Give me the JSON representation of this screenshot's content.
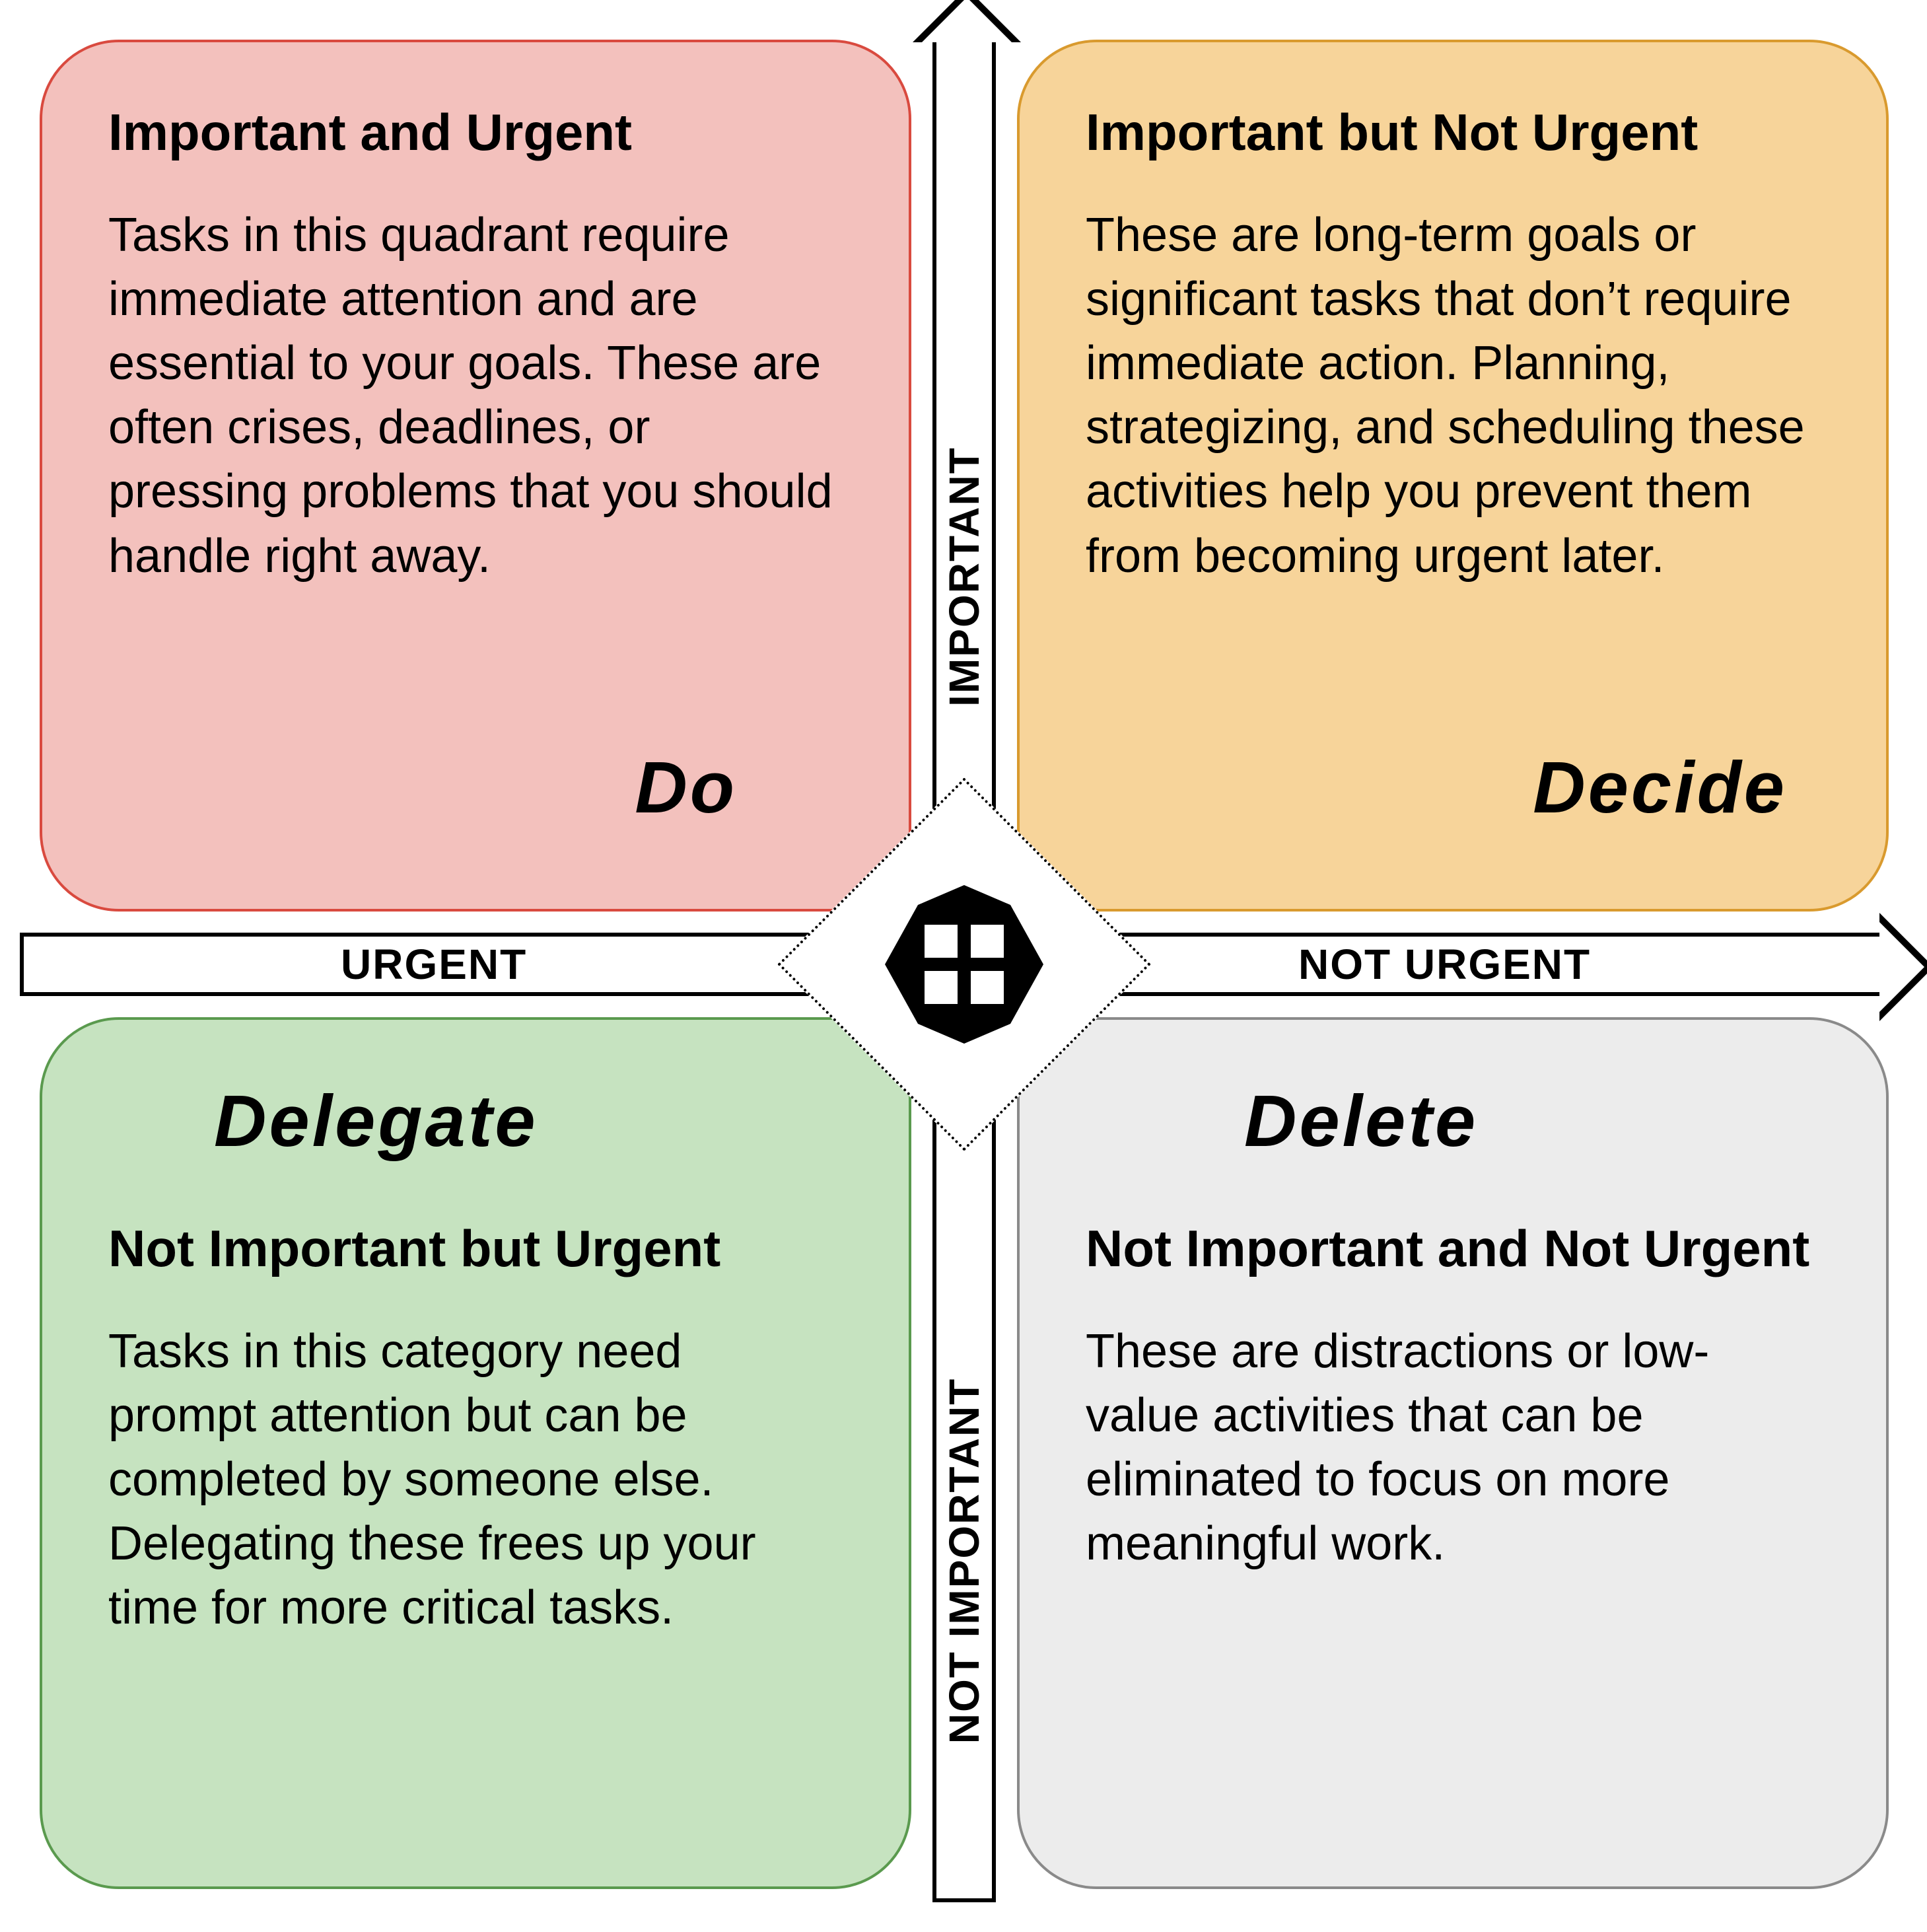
{
  "axes": {
    "vertical_top": "IMPORTANT",
    "vertical_bottom": "NOT IMPORTANT",
    "horizontal_left": "URGENT",
    "horizontal_right": "NOT URGENT"
  },
  "quadrants": {
    "do": {
      "title": "Important and Urgent",
      "desc": "Tasks in this quadrant require immediate attention and are essential to your goals. These are often crises, deadlines, or pressing problems that you should handle right away.",
      "action": "Do",
      "fill": "#f3c1bd",
      "stroke": "#d94a3f"
    },
    "decide": {
      "title": "Important but Not Urgent",
      "desc": "These are long-term goals or significant tasks that don’t require immediate action. Planning, strategizing, and scheduling these activities help you prevent them from becoming urgent later.",
      "action": "Decide",
      "fill": "#f7d49a",
      "stroke": "#d99a2e"
    },
    "delegate": {
      "title": "Not Important but Urgent",
      "desc": "Tasks in this category need prompt attention but can be completed by someone else. Delegating these frees up your time for more critical tasks.",
      "action": "Delegate",
      "fill": "#c6e3c0",
      "stroke": "#5a9a4e"
    },
    "delete": {
      "title": "Not Important and Not Urgent",
      "desc": "These are distractions or low-value activities that can be eliminated to focus on more meaningful work.",
      "action": "Delete",
      "fill": "#ececec",
      "stroke": "#8a8a8a"
    }
  },
  "center_icon": "four-squares-icon"
}
